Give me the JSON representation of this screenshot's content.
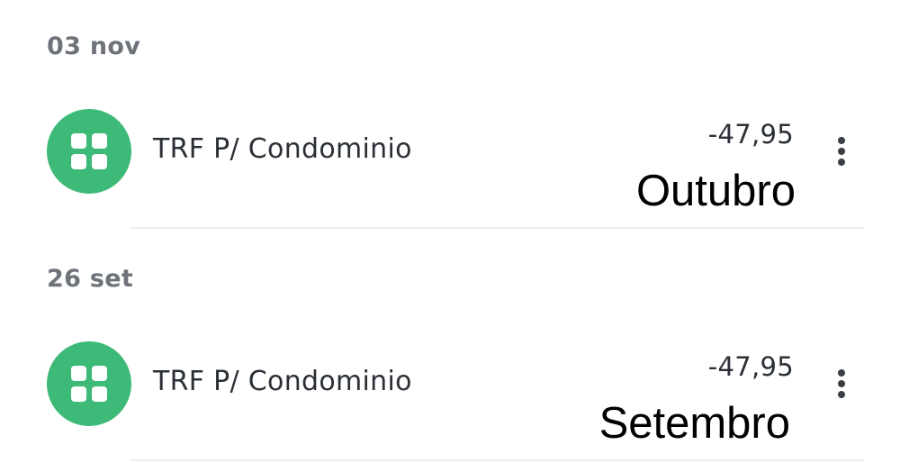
{
  "transactions": [
    {
      "date": "03 nov",
      "icon": "grid-category-icon",
      "icon_color": "#3dba78",
      "description": "TRF P/ Condominio",
      "amount": "-47,95",
      "note": "Outubro",
      "menu_icon": "more-vertical-icon"
    },
    {
      "date": "26 set",
      "icon": "grid-category-icon",
      "icon_color": "#3dba78",
      "description": "TRF P/ Condominio",
      "amount": "-47,95",
      "note": "Setembro",
      "menu_icon": "more-vertical-icon"
    }
  ]
}
